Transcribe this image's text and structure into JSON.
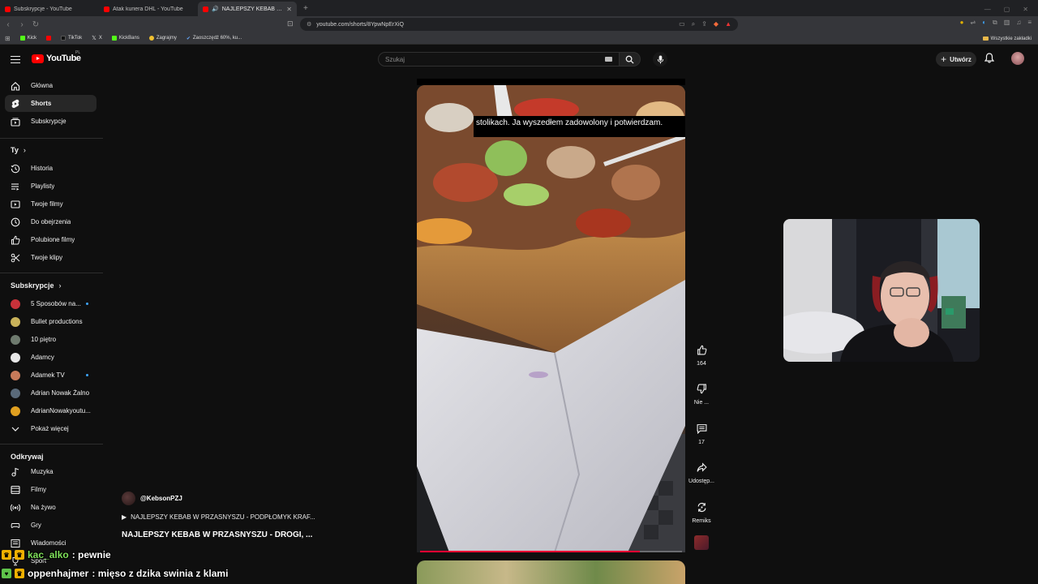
{
  "browser": {
    "tabs": [
      {
        "label": "Subskrypcje - YouTube",
        "active": false
      },
      {
        "label": "Atak kuriera DHL - YouTube",
        "active": false
      },
      {
        "label": "NAJLEPSZY KEBAB W PRZASNYSZU",
        "active": true
      }
    ],
    "url": "youtube.com/shorts/8YpwNpErXiQ",
    "bookmarks": [
      "Kick",
      "TikTok",
      "X",
      "KickBans",
      "Zagrajmy",
      "Zaoszczędź 60%, ku..."
    ],
    "bookmarks_all": "Wszystkie zakładki"
  },
  "masthead": {
    "logo": "YouTube",
    "region": "PL",
    "search_placeholder": "Szukaj",
    "create_label": "Utwórz"
  },
  "sidebar": {
    "main": [
      {
        "label": "Główna",
        "icon": "home-icon"
      },
      {
        "label": "Shorts",
        "icon": "shorts-icon",
        "active": true
      },
      {
        "label": "Subskrypcje",
        "icon": "subscriptions-icon"
      }
    ],
    "you_heading": "Ty",
    "you": [
      {
        "label": "Historia",
        "icon": "history-icon"
      },
      {
        "label": "Playlisty",
        "icon": "playlist-icon"
      },
      {
        "label": "Twoje filmy",
        "icon": "your-videos-icon"
      },
      {
        "label": "Do obejrzenia",
        "icon": "watch-later-icon"
      },
      {
        "label": "Polubione filmy",
        "icon": "liked-icon"
      },
      {
        "label": "Twoje klipy",
        "icon": "clips-icon"
      }
    ],
    "subs_heading": "Subskrypcje",
    "subs": [
      {
        "label": "5 Sposobów na...",
        "color": "#c8323a",
        "new": true
      },
      {
        "label": "Bullet productions",
        "color": "#c9b25a",
        "new": false
      },
      {
        "label": "10 piętro",
        "color": "#6e7a6e",
        "new": false
      },
      {
        "label": "Adamcy",
        "color": "#e8e8e8",
        "new": false
      },
      {
        "label": "Adamek TV",
        "color": "#c77a5a",
        "new": true
      },
      {
        "label": "Adrian Nowak Żalno",
        "color": "#5a6a7a",
        "new": false
      },
      {
        "label": "AdrianNowakyoutu...",
        "color": "#e0a020",
        "new": false
      }
    ],
    "show_more": "Pokaż więcej",
    "explore_heading": "Odkrywaj",
    "explore": [
      {
        "label": "Muzyka",
        "icon": "music-icon"
      },
      {
        "label": "Filmy",
        "icon": "movies-icon"
      },
      {
        "label": "Na żywo",
        "icon": "live-icon"
      },
      {
        "label": "Gry",
        "icon": "gaming-icon"
      },
      {
        "label": "Wiadomości",
        "icon": "news-icon"
      },
      {
        "label": "Sport",
        "icon": "sport-icon"
      }
    ]
  },
  "short": {
    "caption": "stolikach. Ja wyszedłem zadowolony i potwierdzam.",
    "progress": 0.84,
    "channel": "@KebsonPZJ",
    "related": "NAJLEPSZY KEBAB W PRZASNYSZU - PODPŁOMYK KRAF...",
    "title": "NAJLEPSZY KEBAB W PRZASNYSZU - DROGI, ...",
    "actions": {
      "likes": "164",
      "dislike": "Nie ...",
      "comments": "17",
      "share": "Udostęp...",
      "remix": "Remiks"
    }
  },
  "chat": [
    {
      "user": "kac_alko",
      "message": ": pewnie"
    },
    {
      "user": "oppenhajmer",
      "message": ": mięso z dzika swinia z klami"
    }
  ]
}
